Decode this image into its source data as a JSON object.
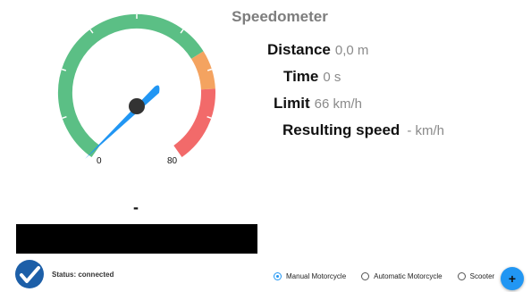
{
  "app": {
    "title": "Speedometer"
  },
  "gauge": {
    "min_label": "0",
    "max_label": "80",
    "current_display": "-",
    "colors": {
      "normal": "#5bbf85",
      "warning": "#f4a360",
      "danger": "#f26a6a",
      "needle": "#2196f3"
    }
  },
  "stats": {
    "distance_label": "Distance",
    "distance_value": "0,0 m",
    "time_label": "Time",
    "time_value": "0 s",
    "limit_label": "Limit",
    "limit_value": "66 km/h",
    "speed_label": "Resulting speed",
    "speed_value": "- km/h"
  },
  "status": {
    "text": "Status: connected",
    "icon": "check-circle-icon"
  },
  "vehicles": {
    "options": [
      "Manual Motorcycle",
      "Automatic Motorcycle",
      "Scooter"
    ],
    "selected": "Manual Motorcycle"
  },
  "fab": {
    "label": "+"
  },
  "colors": {
    "accent": "#2196f3",
    "title": "#7d7d7d"
  }
}
